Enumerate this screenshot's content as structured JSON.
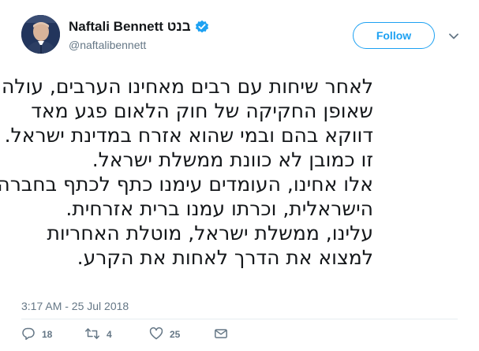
{
  "author": {
    "name": "Naftali Bennett בנט",
    "handle": "@naftalibennett",
    "verified_icon": "verified-badge-icon",
    "avatar_icon": "avatar"
  },
  "follow_button": {
    "label": "Follow"
  },
  "menu_icon": "chevron-down-icon",
  "tweet": {
    "lines": [
      "לאחר שיחות עם רבים מאחינו הערבים, עולה",
      "שאופן החקיקה של חוק הלאום פגע מאד",
      "דווקא בהם ובמי שהוא אזרח במדינת ישראל.",
      "זו כמובן לא כוונת ממשלת ישראל.",
      "אלו אחינו, העומדים עימנו כתף לכתף בחברה",
      "הישראלית, וכרתו עמנו ברית אזרחית.",
      "עלינו, ממשלת ישראל, מוטלת האחריות",
      "למצוא את הדרך לאחות את הקרע."
    ]
  },
  "timestamp": "3:17 AM - 25 Jul 2018",
  "actions": {
    "reply": {
      "icon": "reply-icon",
      "count": "18"
    },
    "retweet": {
      "icon": "retweet-icon",
      "count": "4"
    },
    "like": {
      "icon": "heart-icon",
      "count": "25"
    },
    "dm": {
      "icon": "envelope-icon"
    }
  },
  "colors": {
    "accent": "#1da1f2",
    "secondary_text": "#657786",
    "primary_text": "#14171a",
    "divider": "#e6ecf0"
  }
}
